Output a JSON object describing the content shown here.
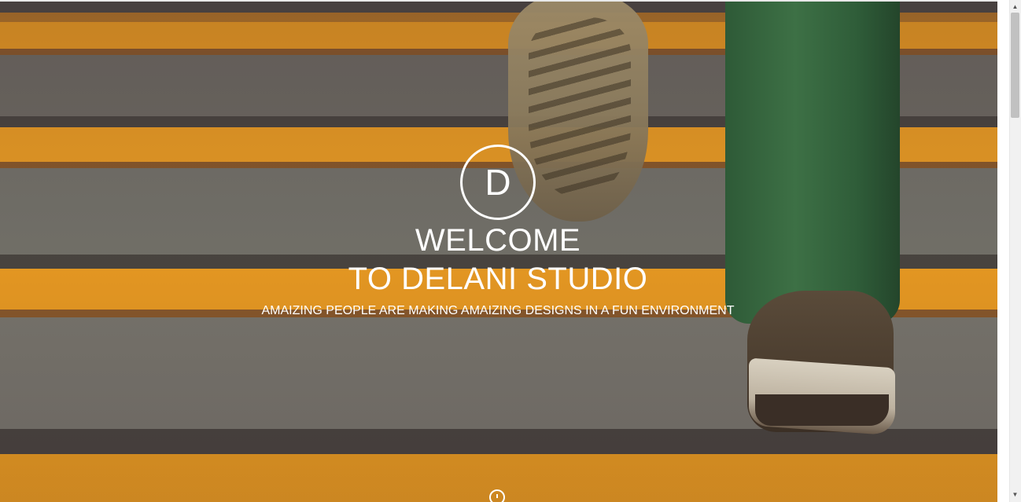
{
  "hero": {
    "logo_letter": "D",
    "title_line1": "WELCOME",
    "title_line2": "TO DELANI STUDIO",
    "subtitle": "AMAIZING PEOPLE ARE MAKING AMAIZING DESIGNS IN A FUN ENVIRONMENT",
    "background_image": "stairs-walking-photo"
  },
  "icons": {
    "scroll_down": "scroll-down-icon",
    "scroll_up_arrow": "▲",
    "scroll_down_arrow": "▼"
  },
  "colors": {
    "stair_orange": "#f0a020",
    "stair_gray": "#76756b",
    "text": "#ffffff",
    "pants_green": "#3d7045"
  }
}
